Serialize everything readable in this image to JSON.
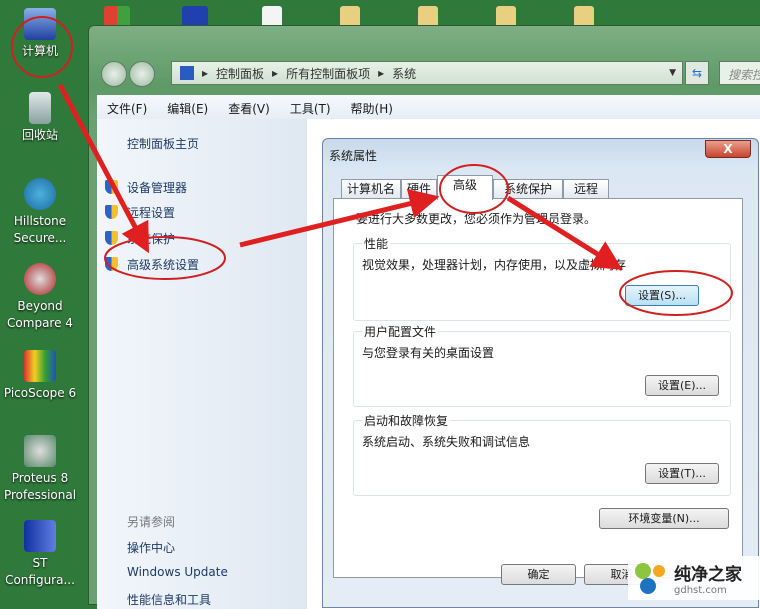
{
  "desktop": {
    "icons": [
      "计算机",
      "回收站",
      "Hillstone Secure...",
      "Beyond Compare 4",
      "PicoScope 6",
      "Proteus 8 Professional",
      "ST Configura..."
    ]
  },
  "explorer": {
    "breadcrumb": [
      "控制面板",
      "所有控制面板项",
      "系统"
    ],
    "search_placeholder": "搜索控",
    "menu": [
      "文件(F)",
      "编辑(E)",
      "查看(V)",
      "工具(T)",
      "帮助(H)"
    ],
    "left": {
      "home": "控制面板主页",
      "tasks": [
        "设备管理器",
        "远程设置",
        "系统保护",
        "高级系统设置"
      ],
      "see_also_title": "另请参阅",
      "see_also": [
        "操作中心",
        "Windows Update",
        "性能信息和工具"
      ]
    }
  },
  "dialog": {
    "title": "系统属性",
    "close": "X",
    "tabs": [
      "计算机名",
      "硬件",
      "高级",
      "系统保护",
      "远程"
    ],
    "active_tab": "高级",
    "admin_note": "要进行大多数更改，您必须作为管理员登录。",
    "groups": [
      {
        "title": "性能",
        "desc": "视觉效果，处理器计划，内存使用，以及虚拟内存",
        "button": "设置(S)..."
      },
      {
        "title": "用户配置文件",
        "desc": "与您登录有关的桌面设置",
        "button": "设置(E)..."
      },
      {
        "title": "启动和故障恢复",
        "desc": "系统启动、系统失败和调试信息",
        "button": "设置(T)..."
      }
    ],
    "env_button": "环境变量(N)...",
    "ok": "确定",
    "cancel": "取消"
  },
  "watermark": {
    "name": "纯净之家",
    "url": "gdhst.com"
  },
  "colors": {
    "annotation": "#e02020",
    "desktop": "#2f7a3a"
  }
}
